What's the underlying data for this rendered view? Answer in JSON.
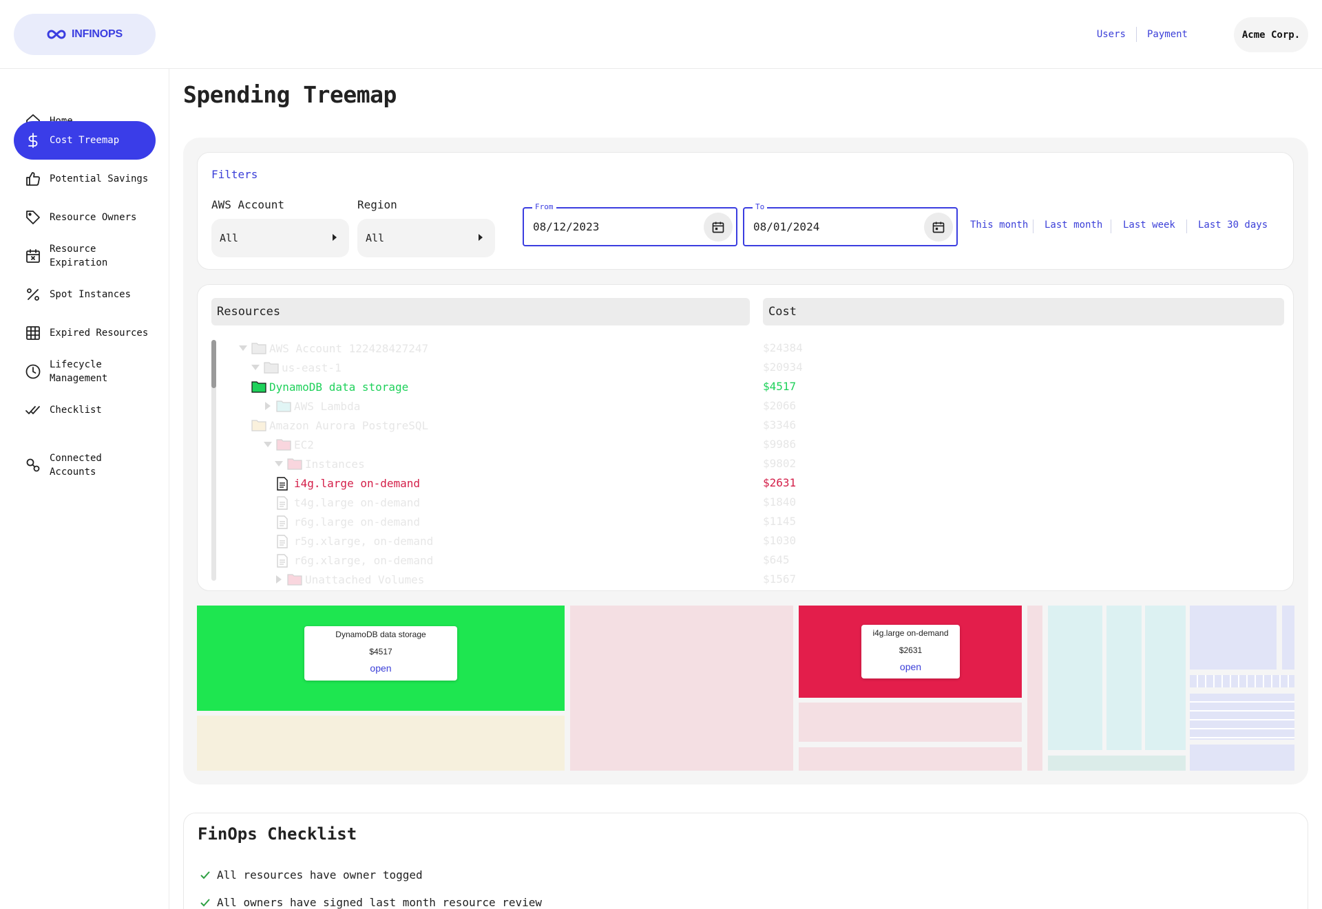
{
  "header": {
    "logo_text": "INFINOPS",
    "links": [
      "Users",
      "Payment"
    ],
    "company": "Acme Corp."
  },
  "sidebar": {
    "items": [
      {
        "label": "Home",
        "icon": "home-icon",
        "active": false
      },
      {
        "label": "Cost Treemap",
        "icon": "dollar-icon",
        "active": true
      },
      {
        "label": "Potential Savings",
        "icon": "thumbs-up-icon",
        "active": false
      },
      {
        "label": "Resource Owners",
        "icon": "tag-icon",
        "active": false
      },
      {
        "label": "Resource Expiration",
        "icon": "calendar-x-icon",
        "active": false
      },
      {
        "label": "Spot Instances",
        "icon": "percent-icon",
        "active": false
      },
      {
        "label": "Expired Resources",
        "icon": "grid-table-icon",
        "active": false
      },
      {
        "label": "Lifecycle Management",
        "icon": "clock-icon",
        "active": false
      },
      {
        "label": "Checklist",
        "icon": "double-check-icon",
        "active": false
      },
      {
        "label": "Connected Accounts",
        "icon": "link-nodes-icon",
        "active": false
      }
    ]
  },
  "page": {
    "title": "Spending Treemap"
  },
  "filters": {
    "title": "Filters",
    "aws_account": {
      "label": "AWS Account",
      "value": "All"
    },
    "region": {
      "label": "Region",
      "value": "All"
    },
    "from": {
      "label": "From",
      "value": "08/12/2023"
    },
    "to": {
      "label": "To",
      "value": "08/01/2024"
    },
    "quick_ranges": [
      "This month",
      "Last month",
      "Last week",
      "Last 30 days"
    ]
  },
  "tree": {
    "headers": {
      "resources": "Resources",
      "cost": "Cost"
    },
    "rows": [
      {
        "name": "AWS Account 122428427247",
        "cost": "$24384",
        "kind": "folder",
        "chev": "down",
        "dim": true,
        "color": "#9a9a9a"
      },
      {
        "name": "us-east-1",
        "cost": "$20934",
        "kind": "folder",
        "chev": "down",
        "dim": true,
        "color": "#9a9a9a"
      },
      {
        "name": "DynamoDB data storage",
        "cost": "$4517",
        "kind": "folder",
        "chev": "none",
        "dim": false,
        "color": "#1ed15a"
      },
      {
        "name": "AWS Lambda",
        "cost": "$2066",
        "kind": "folder",
        "chev": "right",
        "dim": true,
        "color": "#5ec9c9"
      },
      {
        "name": "Amazon Aurora PostgreSQL",
        "cost": "$3346",
        "kind": "folder",
        "chev": "none",
        "dim": true,
        "color": "#e8b34a"
      },
      {
        "name": "EC2",
        "cost": "$9986",
        "kind": "folder",
        "chev": "down",
        "dim": true,
        "color": "#e0224f"
      },
      {
        "name": "Instances",
        "cost": "$9802",
        "kind": "folder",
        "chev": "down",
        "dim": true,
        "color": "#e0224f"
      },
      {
        "name": "i4g.large on-demand",
        "cost": "$2631",
        "kind": "file",
        "chev": "none",
        "dim": false,
        "color": "#d4204a"
      },
      {
        "name": "t4g.large on-demand",
        "cost": "$1840",
        "kind": "file",
        "chev": "none",
        "dim": true,
        "color": "#9a9a9a"
      },
      {
        "name": "r6g.large on-demand",
        "cost": "$1145",
        "kind": "file",
        "chev": "none",
        "dim": true,
        "color": "#9a9a9a"
      },
      {
        "name": "r5g.xlarge, on-demand",
        "cost": "$1030",
        "kind": "file",
        "chev": "none",
        "dim": true,
        "color": "#9a9a9a"
      },
      {
        "name": "r6g.xlarge, on-demand",
        "cost": "$645",
        "kind": "file",
        "chev": "none",
        "dim": true,
        "color": "#9a9a9a"
      },
      {
        "name": "Unattached Volumes",
        "cost": "$1567",
        "kind": "folder",
        "chev": "right",
        "dim": true,
        "color": "#e0224f"
      }
    ]
  },
  "treemap": {
    "tooltips": [
      {
        "name": "DynamoDB data storage",
        "cost": "$4517",
        "action": "open"
      },
      {
        "name": "i4g.large on-demand",
        "cost": "$2631",
        "action": "open"
      }
    ]
  },
  "checklist": {
    "title": "FinOps Checklist",
    "items": [
      "All resources have owner togged",
      "All owners have signed last month resource review"
    ]
  },
  "colors": {
    "accent": "#3a3de8",
    "dynamo_green": "#1ee650",
    "ec2_red": "#e31e4b"
  }
}
